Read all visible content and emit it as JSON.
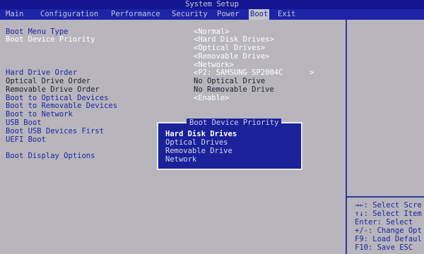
{
  "title": "System Setup",
  "menu": {
    "items": [
      "Main",
      "Configuration",
      "Performance",
      "Security",
      "Power",
      "Boot",
      "Exit"
    ],
    "active": "Boot"
  },
  "settings": {
    "boot_menu_type": {
      "label": "Boot Menu Type",
      "value": "<Normal>"
    },
    "boot_device_priority": {
      "label": "Boot Device Priority",
      "values": [
        "<Hard Disk Drives>",
        "<Optical Drives>",
        "<Removable Drive>",
        "<Network>"
      ]
    },
    "hard_drive_order": {
      "label": "Hard Drive Order",
      "value": "<P2: SAMSUNG SP2004C",
      "arrow": ">"
    },
    "optical_drive_order": {
      "label": "Optical Drive Order",
      "value": "No Optical Drive"
    },
    "removable_drive_order": {
      "label": "Removable Drive Order",
      "value": "No Removable Drive"
    },
    "boot_to_optical": {
      "label": "Boot to Optical Devices",
      "value": "<Enable>"
    },
    "boot_to_removable": {
      "label": "Boot to Removable Devices"
    },
    "boot_to_network": {
      "label": "Boot to Network"
    },
    "usb_boot": {
      "label": "USB Boot"
    },
    "boot_usb_first": {
      "label": "Boot USB Devices First"
    },
    "uefi_boot": {
      "label": "UEFI Boot"
    },
    "boot_display_options": {
      "label": "Boot Display Options"
    }
  },
  "popup": {
    "title": "Boot Device Priority",
    "options": [
      "Hard Disk Drives",
      "Optical Drives",
      "Removable Drive",
      "Network"
    ],
    "selected": "Hard Disk Drives"
  },
  "help": [
    "→←: Select Scre",
    "↑↓: Select Item",
    "Enter: Select",
    "+/-: Change Opt",
    "F9: Load Defaul",
    "F10: Save  ESC"
  ],
  "colors": {
    "bios_blue": "#1a2199",
    "panel_gray": "#b8b6bc",
    "label_blue": "#1b25a0"
  }
}
